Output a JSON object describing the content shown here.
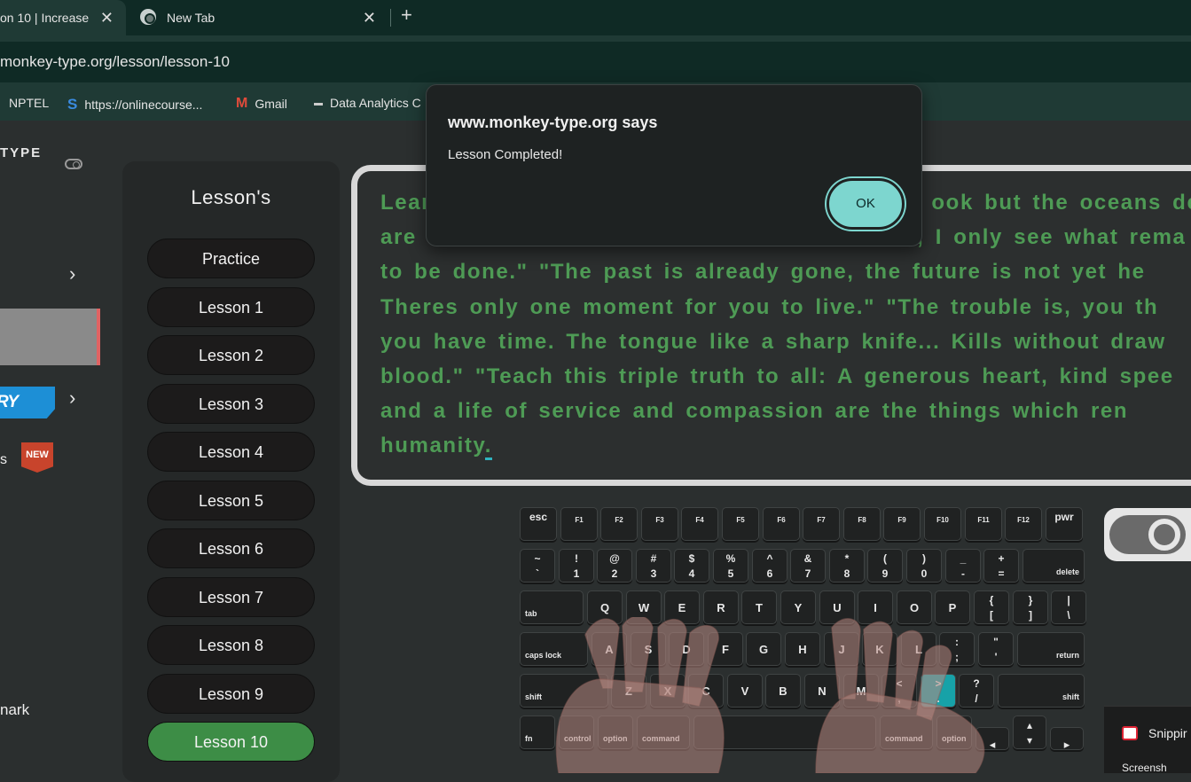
{
  "browser": {
    "tabs": [
      {
        "title": "on 10 | Increase",
        "active": true
      },
      {
        "title": "New Tab",
        "active": false
      }
    ],
    "close_glyph": "✕",
    "new_tab_glyph": "+",
    "url": "monkey-type.org/lesson/lesson-10",
    "bookmarks": [
      {
        "label": "NPTEL",
        "icon": ""
      },
      {
        "label": "https://onlinecourse...",
        "icon": "S"
      },
      {
        "label": "Gmail",
        "icon": "M"
      },
      {
        "label": "Data Analytics C",
        "icon": "▬"
      }
    ]
  },
  "nav": {
    "brand": "TYPE",
    "try_now": "RY NOW",
    "new_badge": "NEW",
    "item_s": "s",
    "item_mark": "nark",
    "chevron": "›"
  },
  "lessons": {
    "title": "Lesson's",
    "items": [
      "Practice",
      "Lesson 1",
      "Lesson 2",
      "Lesson 3",
      "Lesson 4",
      "Lesson 5",
      "Lesson 6",
      "Lesson 7",
      "Lesson 8",
      "Lesson 9",
      "Lesson 10"
    ],
    "active": "Lesson 10"
  },
  "typing_text": {
    "lines": [
      "Lear                                              ook but the oceans dep",
      "are                                              , I only see what rema",
      "to be done.\" \"The past is already gone, the future is not yet he",
      "Theres only one moment for you to live.\" \"The trouble is, you th",
      "you have time. The tongue like a sharp knife... Kills without draw",
      "blood.\" \"Teach this triple truth to all: A generous heart, kind spee",
      "and a life of service and compassion are the things which ren",
      "humanity"
    ],
    "cursor_char": "."
  },
  "keyboard": {
    "row_fn": [
      "esc",
      "F1",
      "F2",
      "F3",
      "F4",
      "F5",
      "F6",
      "F7",
      "F8",
      "F9",
      "F10",
      "F11",
      "F12",
      "pwr"
    ],
    "row_num": [
      [
        "~",
        "`"
      ],
      [
        "!",
        "1"
      ],
      [
        "@",
        "2"
      ],
      [
        "#",
        "3"
      ],
      [
        "$",
        "4"
      ],
      [
        "%",
        "5"
      ],
      [
        "^",
        "6"
      ],
      [
        "&",
        "7"
      ],
      [
        "*",
        "8"
      ],
      [
        "(",
        "9"
      ],
      [
        ")",
        "0"
      ],
      [
        "_",
        "-"
      ],
      [
        "+",
        "="
      ]
    ],
    "delete": "delete",
    "tab": "tab",
    "row_q": [
      "Q",
      "W",
      "E",
      "R",
      "T",
      "Y",
      "U",
      "I",
      "O",
      "P"
    ],
    "row_q_sym": [
      [
        "{",
        "["
      ],
      [
        "}",
        "]"
      ],
      [
        "|",
        "\\"
      ]
    ],
    "caps": "caps lock",
    "row_a": [
      "A",
      "S",
      "D",
      "F",
      "G",
      "H",
      "J",
      "K",
      "L"
    ],
    "row_a_sym": [
      [
        ":",
        ";"
      ],
      [
        "\"",
        "'"
      ]
    ],
    "return": "return",
    "shift": "shift",
    "row_z": [
      "Z",
      "X",
      "C",
      "V",
      "B",
      "N",
      "M"
    ],
    "row_z_sym": [
      [
        "<",
        ","
      ],
      [
        ">",
        "."
      ],
      [
        "?",
        "/"
      ]
    ],
    "fn": "fn",
    "control": "control",
    "option": "option",
    "command": "command",
    "arrows": {
      "left": "◂",
      "up": "▴",
      "down": "▾",
      "right": "▸"
    },
    "highlight_key": ">"
  },
  "widgets": {
    "snipping": "Snippir",
    "snipping_sub": "Screensh"
  },
  "dialog": {
    "title": "www.monkey-type.org says",
    "message": "Lesson Completed!",
    "ok": "OK"
  },
  "colors": {
    "accent_teal": "#7dd6cf",
    "typed_green": "#4e9b55",
    "active_lesson": "#3d8d46",
    "highlight_key": "#17a2a8"
  }
}
